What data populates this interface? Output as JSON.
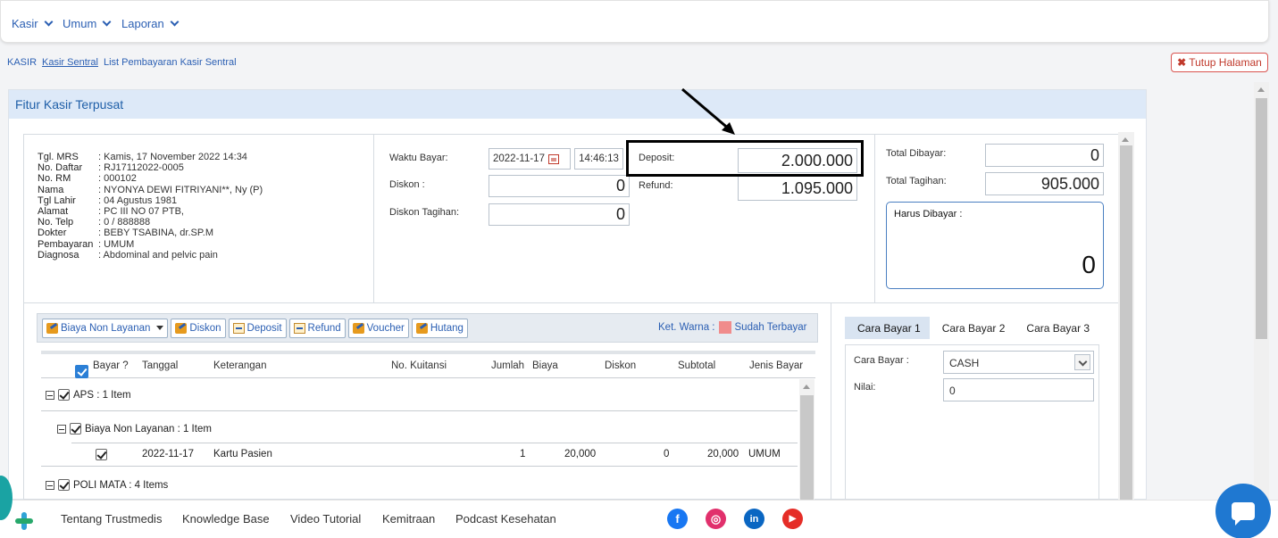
{
  "nav": {
    "menus": [
      "Kasir",
      "Umum",
      "Laporan"
    ]
  },
  "breadcrumb": [
    "KASIR",
    "Kasir Sentral",
    "List Pembayaran Kasir Sentral"
  ],
  "close_button": "Tutup Halaman",
  "panel_title": "Fitur Kasir Terpusat",
  "patient": [
    {
      "label": "Tgl. MRS",
      "value": ": Kamis, 17 November 2022 14:34"
    },
    {
      "label": "No. Daftar",
      "value": ": RJ17112022-0005"
    },
    {
      "label": "No. RM",
      "value": ": 000102"
    },
    {
      "label": "Nama",
      "value": ": NYONYA DEWI FITRIYANI**, Ny (P)"
    },
    {
      "label": "Tgl Lahir",
      "value": ": 04 Agustus 1981"
    },
    {
      "label": "Alamat",
      "value": ": PC III NO 07 PTB,"
    },
    {
      "label": "No. Telp",
      "value": ": 0 / 888888"
    },
    {
      "label": "Dokter",
      "value": ": BEBY TSABINA, dr.SP.M"
    },
    {
      "label": "Pembayaran",
      "value": ": UMUM"
    },
    {
      "label": "Diagnosa",
      "value": ": Abdominal and pelvic pain"
    }
  ],
  "payment": {
    "waktu_label": "Waktu Bayar:",
    "waktu_date": "2022-11-17",
    "waktu_time": "14:46:13",
    "diskon_label": "Diskon :",
    "diskon_value": "0",
    "diskon_tagihan_label": "Diskon Tagihan:",
    "diskon_tagihan_value": "0",
    "deposit_label": "Deposit:",
    "deposit_value": "2.000.000",
    "refund_label": "Refund:",
    "refund_value": "1.095.000",
    "total_dibayar_label": "Total Dibayar:",
    "total_dibayar_value": "0",
    "total_tagihan_label": "Total Tagihan:",
    "total_tagihan_value": "905.000",
    "harus_label": "Harus Dibayar :",
    "harus_value": "0"
  },
  "toolbar": {
    "buttons": [
      "Biaya Non Layanan",
      "Diskon",
      "Deposit",
      "Refund",
      "Voucher",
      "Hutang"
    ],
    "ket_label": "Ket. Warna :",
    "ket_value": "Sudah Terbayar",
    "ket_color": "#f08c8c"
  },
  "grid": {
    "headers": [
      "Bayar ?",
      "Tanggal",
      "Keterangan",
      "No. Kuitansi",
      "Jumlah",
      "Biaya",
      "Diskon",
      "Subtotal",
      "Jenis Bayar"
    ],
    "group1": "APS : 1 Item",
    "subgroup1": "Biaya Non Layanan : 1 Item",
    "row1": {
      "tanggal": "2022-11-17",
      "keterangan": "Kartu Pasien",
      "jumlah": "1",
      "biaya": "20,000",
      "diskon": "0",
      "subtotal": "20,000",
      "jenis": "UMUM"
    },
    "group2": "POLI MATA : 4 Items"
  },
  "paytabs": [
    "Cara Bayar 1",
    "Cara Bayar 2",
    "Cara Bayar 3"
  ],
  "payform": {
    "cara_label": "Cara Bayar :",
    "cara_value": "CASH",
    "nilai_label": "Nilai:",
    "nilai_value": "0"
  },
  "footer": {
    "links": [
      "Tentang Trustmedis",
      "Knowledge Base",
      "Video Tutorial",
      "Kemitraan",
      "Podcast Kesehatan"
    ],
    "social": [
      {
        "name": "facebook-icon",
        "glyph": "f",
        "color": "#1877f2"
      },
      {
        "name": "instagram-icon",
        "glyph": "◎",
        "color": "#e1306c"
      },
      {
        "name": "linkedin-icon",
        "glyph": "in",
        "color": "#0a66c2"
      },
      {
        "name": "youtube-icon",
        "glyph": "▶",
        "color": "#e52d27"
      }
    ]
  }
}
